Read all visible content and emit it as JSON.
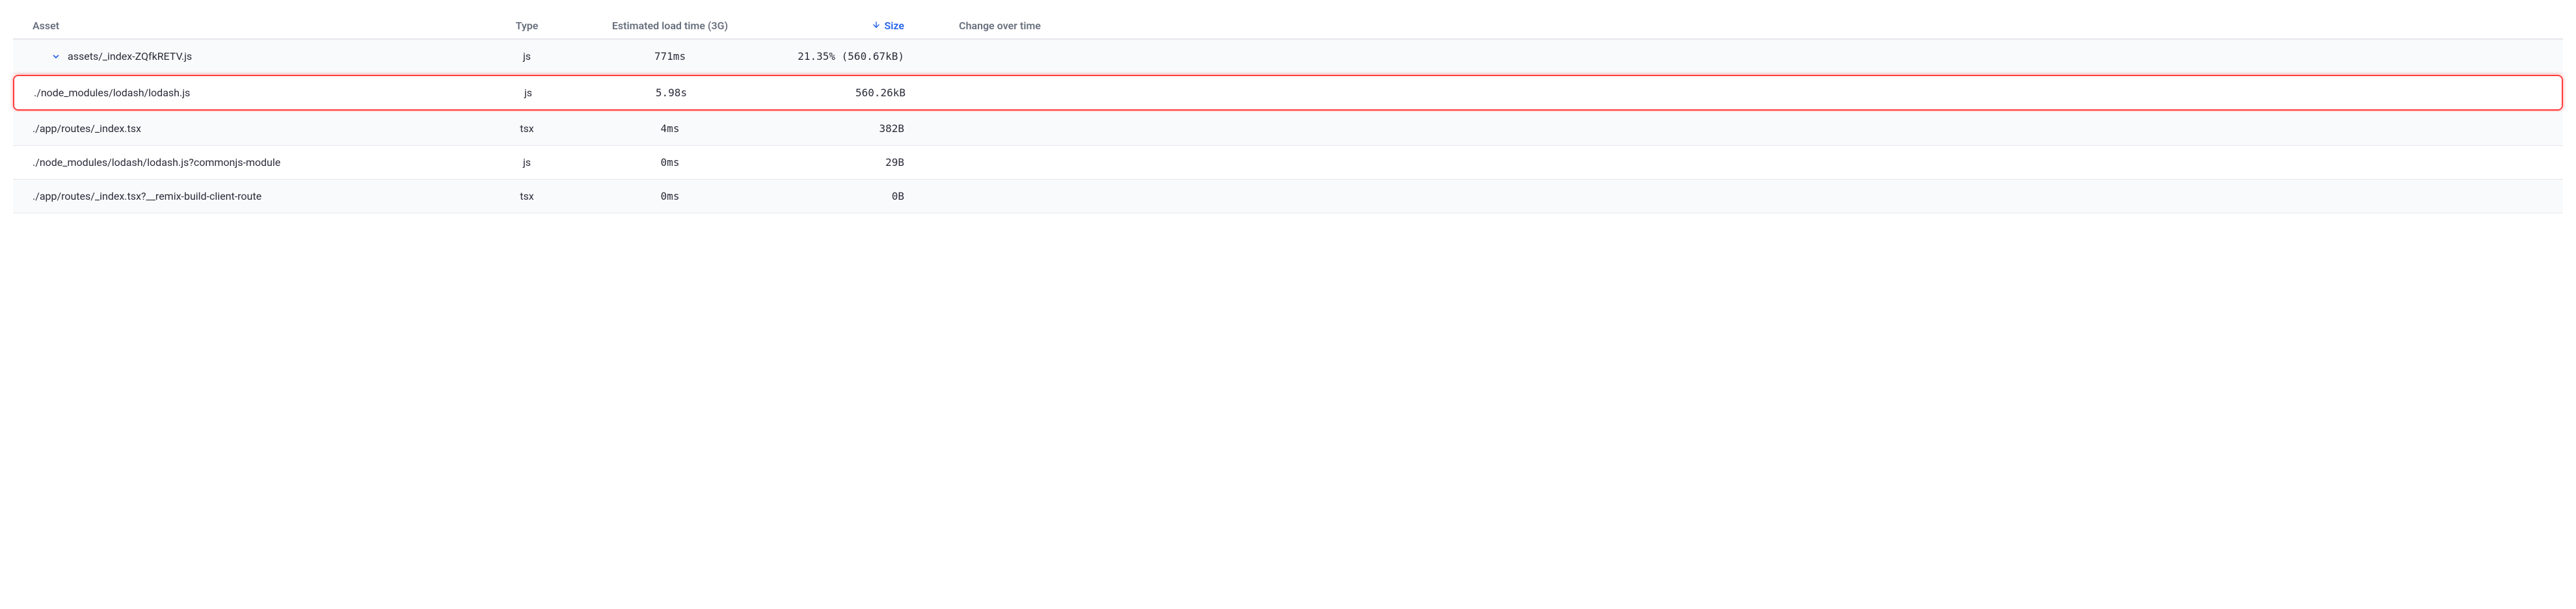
{
  "headers": {
    "asset": "Asset",
    "type": "Type",
    "load_time": "Estimated load time (3G)",
    "size": "Size",
    "change": "Change over time"
  },
  "sort": {
    "column": "size",
    "direction": "desc"
  },
  "rows": [
    {
      "asset": "assets/_index-ZQfkRETV.js",
      "type": "js",
      "load_time": "771ms",
      "size": "21.35% (560.67kB)",
      "change": "",
      "expandable": true,
      "expanded": true,
      "highlighted": false,
      "level": 0
    },
    {
      "asset": "./node_modules/lodash/lodash.js",
      "type": "js",
      "load_time": "5.98s",
      "size": "560.26kB",
      "change": "",
      "expandable": false,
      "expanded": false,
      "highlighted": true,
      "level": 1
    },
    {
      "asset": "./app/routes/_index.tsx",
      "type": "tsx",
      "load_time": "4ms",
      "size": "382B",
      "change": "",
      "expandable": false,
      "expanded": false,
      "highlighted": false,
      "level": 1
    },
    {
      "asset": "./node_modules/lodash/lodash.js?commonjs-module",
      "type": "js",
      "load_time": "0ms",
      "size": "29B",
      "change": "",
      "expandable": false,
      "expanded": false,
      "highlighted": false,
      "level": 1
    },
    {
      "asset": "./app/routes/_index.tsx?__remix-build-client-route",
      "type": "tsx",
      "load_time": "0ms",
      "size": "0B",
      "change": "",
      "expandable": false,
      "expanded": false,
      "highlighted": false,
      "level": 1
    }
  ]
}
